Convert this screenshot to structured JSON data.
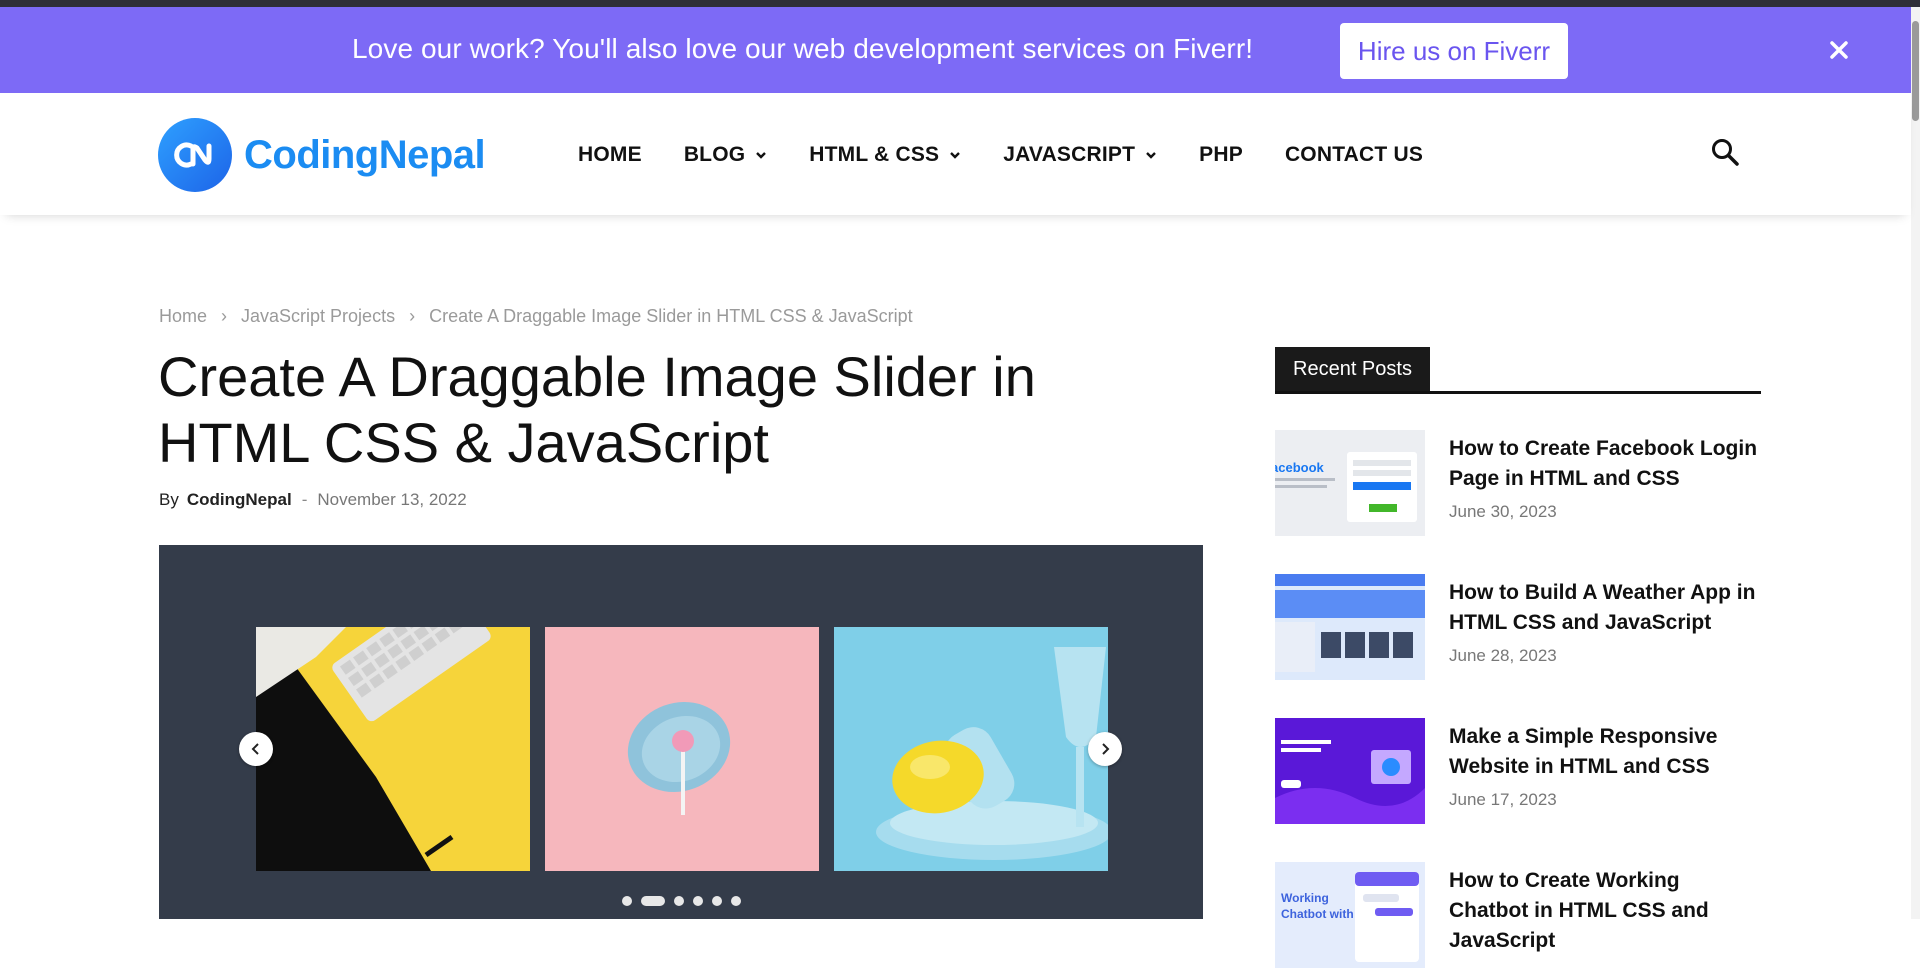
{
  "promo": {
    "text": "Love our work? You'll also love our web development services on Fiverr!",
    "button_label": "Hire us on Fiverr",
    "close_icon": "close-icon"
  },
  "header": {
    "logo_text": "CodingNepal",
    "nav": [
      {
        "label": "HOME",
        "has_dropdown": false
      },
      {
        "label": "BLOG",
        "has_dropdown": true
      },
      {
        "label": "HTML & CSS",
        "has_dropdown": true
      },
      {
        "label": "JAVASCRIPT",
        "has_dropdown": true
      },
      {
        "label": "PHP",
        "has_dropdown": false
      },
      {
        "label": "CONTACT US",
        "has_dropdown": false
      }
    ],
    "search_icon": "search-icon"
  },
  "breadcrumb": {
    "items": [
      "Home",
      "JavaScript Projects",
      "Create A Draggable Image Slider in HTML CSS & JavaScript"
    ],
    "separator": "›"
  },
  "article": {
    "title": "Create A Draggable Image Slider in HTML CSS & JavaScript",
    "by_label": "By",
    "author": "CodingNepal",
    "dash": "-",
    "date": "November 13, 2022"
  },
  "slider": {
    "slides": [
      "keyboard-on-yellow",
      "pink-lollipop",
      "lemon-on-blue-plate"
    ],
    "dot_count": 6,
    "active_dot": 1,
    "prev_icon": "chevron-left-icon",
    "next_icon": "chevron-right-icon"
  },
  "sidebar": {
    "widget_title": "Recent Posts",
    "posts": [
      {
        "title": "How to Create Facebook Login Page in HTML and CSS",
        "date": "June 30, 2023"
      },
      {
        "title": "How to Build A Weather App in HTML CSS and JavaScript",
        "date": "June 28, 2023"
      },
      {
        "title": "Make a Simple Responsive Website in HTML and CSS",
        "date": "June 17, 2023"
      },
      {
        "title": "How to Create Working Chatbot in HTML CSS and JavaScript",
        "date": ""
      }
    ]
  },
  "colors": {
    "promo_bg": "#7d6af6",
    "brand_blue": "#1b8cf2",
    "slider_bg": "#343c4a",
    "widget_head": "#1a1a1a"
  }
}
